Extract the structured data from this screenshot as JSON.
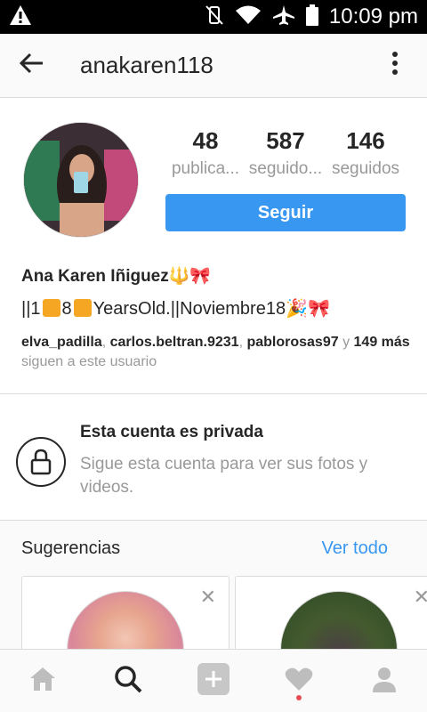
{
  "status_bar": {
    "time": "10:09 pm",
    "icons": [
      "warning-icon",
      "vibrate-off-icon",
      "wifi-icon",
      "airplane-icon",
      "battery-icon"
    ]
  },
  "top_bar": {
    "username": "anakaren118",
    "back_icon": "arrow-left-icon",
    "menu_icon": "more-vertical-icon"
  },
  "profile": {
    "stats": [
      {
        "value": "48",
        "label": "publica..."
      },
      {
        "value": "587",
        "label": "seguido..."
      },
      {
        "value": "146",
        "label": "seguidos"
      }
    ],
    "follow_button": "Seguir",
    "full_name": "Ana Karen Iñiguez🔱🎀",
    "bio_start": "||1",
    "bio_mid": "8",
    "bio_end": "YearsOld.||Noviembre18🎉🎀",
    "followers_names": [
      "elva_padilla",
      "carlos.beltran.9231",
      "pablorosas97"
    ],
    "followers_and": "y",
    "followers_count": "149 más",
    "followers_suffix": "siguen a este usuario"
  },
  "private_notice": {
    "title": "Esta cuenta es privada",
    "description": "Sigue esta cuenta para ver sus fotos y videos.",
    "icon": "lock-icon"
  },
  "suggestions": {
    "heading": "Sugerencias",
    "see_all": "Ver todo",
    "dismiss_symbol": "✕"
  },
  "bottom_nav": {
    "items": [
      "home-icon",
      "search-icon",
      "add-post-icon",
      "activity-heart-icon",
      "profile-icon"
    ],
    "active": "search-icon",
    "accent": "#3897f0",
    "notification_color": "#ed4956"
  }
}
